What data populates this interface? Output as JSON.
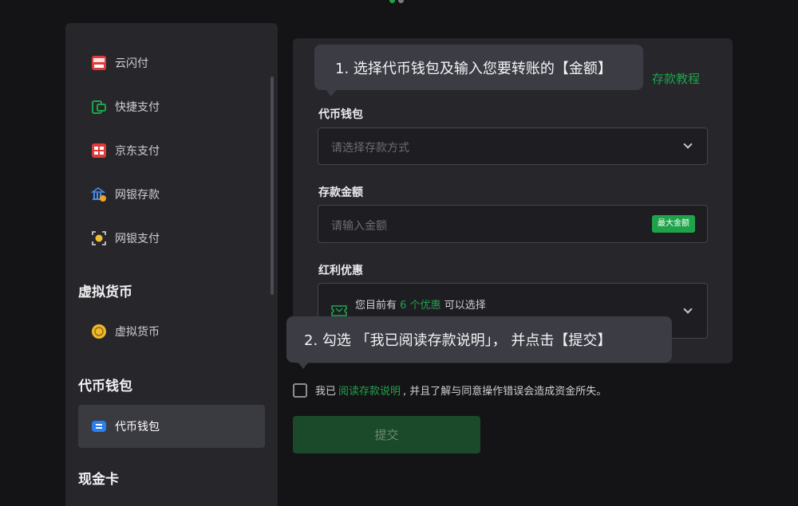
{
  "sidebar": {
    "items": [
      {
        "label": "云闪付",
        "icon": "unionpay-icon"
      },
      {
        "label": "快捷支付",
        "icon": "quick-pay-icon"
      },
      {
        "label": "京东支付",
        "icon": "jd-wallet-icon"
      },
      {
        "label": "网银存款",
        "icon": "bank-deposit-icon"
      },
      {
        "label": "网银支付",
        "icon": "bank-pay-icon"
      }
    ],
    "section_virtual": "虚拟货币",
    "virtual_item": "虚拟货币",
    "section_wallet": "代币钱包",
    "wallet_item": "代币钱包",
    "section_cash": "现金卡"
  },
  "main": {
    "tutorial_link": "存款教程",
    "wallet_label": "代币钱包",
    "wallet_placeholder": "请选择存款方式",
    "amount_label": "存款金额",
    "amount_placeholder": "请输入金额",
    "max_button": "最大金额",
    "promo_label": "红利优惠",
    "promo_prefix": "您目前有",
    "promo_count": "6 个优惠",
    "promo_suffix": "可以选择"
  },
  "tooltips": {
    "step1": "1. 选择代币钱包及输入您要转账的【金额】",
    "step2": "2. 勾选 「我已阅读存款说明」， 并点击【提交】"
  },
  "agreement": {
    "prefix": "我已",
    "link": "阅读存款说明",
    "suffix": ", 并且了解与同意操作错误会造成资金所失。"
  },
  "submit_label": "提交",
  "colors": {
    "accent": "#1fa34a",
    "background": "#141416",
    "panel": "#26262b"
  }
}
